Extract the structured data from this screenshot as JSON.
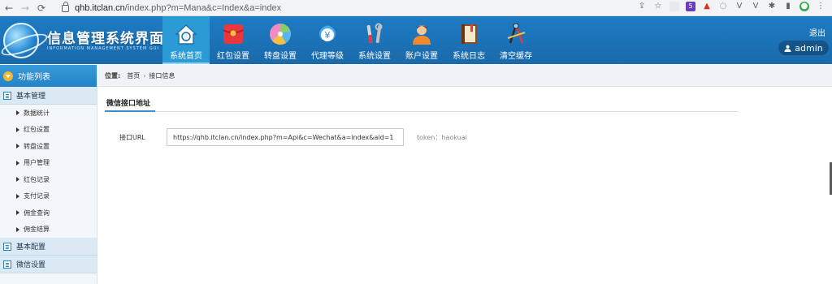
{
  "browser": {
    "url_host": "qhb.itclan.cn",
    "url_rest": "/index.php?m=Mana&c=Index&a=index",
    "extension_badge": "5"
  },
  "header": {
    "logo_title": "信息管理系统界面",
    "logo_subtitle": "INFORMATION MANAGEMENT SYSTEM GUI",
    "logout_label": "退出",
    "user_label": "admin",
    "nav": [
      {
        "label": "系统首页",
        "icon": "home-icon",
        "active": true
      },
      {
        "label": "红包设置",
        "icon": "red-envelope-icon",
        "active": false
      },
      {
        "label": "转盘设置",
        "icon": "wheel-icon",
        "active": false
      },
      {
        "label": "代理等级",
        "icon": "yen-coin-icon",
        "active": false
      },
      {
        "label": "系统设置",
        "icon": "tools-icon",
        "active": false
      },
      {
        "label": "账户设置",
        "icon": "user-icon",
        "active": false
      },
      {
        "label": "系统日志",
        "icon": "book-icon",
        "active": false
      },
      {
        "label": "清空缓存",
        "icon": "compass-icon",
        "active": false
      }
    ]
  },
  "sidebar": {
    "title": "功能列表",
    "groups": [
      {
        "label": "基本管理",
        "items": [
          "数据统计",
          "红包设置",
          "转盘设置",
          "用户管理",
          "红包记录",
          "支付记录",
          "佣金查询",
          "佣金结算"
        ]
      },
      {
        "label": "基本配置",
        "items": []
      },
      {
        "label": "微信设置",
        "items": []
      }
    ]
  },
  "main": {
    "breadcrumb": {
      "label": "位置:",
      "home": "首页",
      "separator": "›",
      "current": "接口信息"
    },
    "section_title": "微信接口地址",
    "field_label": "接口URL",
    "field_value": "https://qhb.itclan.cn/index.php?m=Api&c=Wechat&a=index&aid=1",
    "token_text": "token：haokuai"
  },
  "colors": {
    "header_blue": "#1e7bc4",
    "active_tab": "#2b9bd6",
    "sidebar_head": "#2284c8"
  }
}
